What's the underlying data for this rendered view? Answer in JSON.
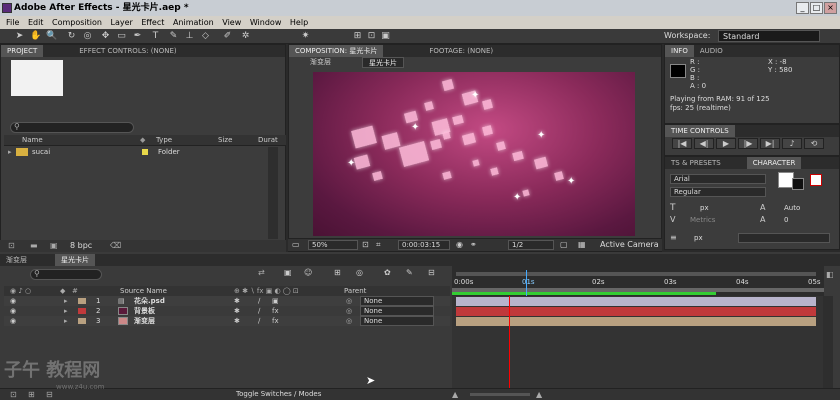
{
  "window": {
    "title": "Adobe After Effects - 星光卡片.aep *",
    "min": "_",
    "max": "□",
    "close": "×"
  },
  "menu": [
    "File",
    "Edit",
    "Composition",
    "Layer",
    "Effect",
    "Animation",
    "View",
    "Window",
    "Help"
  ],
  "workspace": {
    "label": "Workspace:",
    "value": "Standard"
  },
  "project_panel": {
    "tabs": [
      "PROJECT",
      "EFFECT CONTROLS: (none)"
    ],
    "columns": [
      "Name",
      "Type",
      "Size",
      "Durat"
    ],
    "items": [
      {
        "name": "sucai",
        "type": "Folder"
      }
    ],
    "bpc": "8 bpc"
  },
  "comp_panel": {
    "tabs": [
      "COMPOSITION: 星光卡片",
      "FOOTAGE: (none)"
    ],
    "breadcrumbs": [
      "渐变层",
      "星光卡片"
    ],
    "zoom": "50%",
    "timecode": "0:00:03:15",
    "resolution": "1/2",
    "camera": "Active Camera"
  },
  "info_panel": {
    "tabs": [
      "INFO",
      "AUDIO"
    ],
    "r": "R :",
    "g": "G :",
    "b": "B :",
    "a": "A : 0",
    "x": "X : -8",
    "y": "Y : 580",
    "status1": "Playing from RAM: 91 of 125",
    "status2": "fps: 25 (realtime)"
  },
  "time_controls": {
    "tab": "TIME CONTROLS"
  },
  "character_panel": {
    "tabs": [
      "TS & PRESETS",
      "CHARACTER"
    ],
    "font": "Arial",
    "style": "Regular",
    "size_unit": "px",
    "leading": "Auto",
    "metrics": "Metrics",
    "tracking": "0",
    "stroke_unit": "px"
  },
  "timeline": {
    "tabs": [
      "渐变层",
      "星光卡片"
    ],
    "header": {
      "source_name": "Source Name",
      "parent": "Parent"
    },
    "ruler": [
      "0:00s",
      "01s",
      "02s",
      "03s",
      "04s",
      "05s"
    ],
    "layers": [
      {
        "num": "1",
        "name": "花朵.psd",
        "parent": "None",
        "color": "#b8a080"
      },
      {
        "num": "2",
        "name": "背景板",
        "parent": "None",
        "color": "#c0393b"
      },
      {
        "num": "3",
        "name": "渐变层",
        "parent": "None",
        "color": "#b8a080"
      }
    ],
    "toggle": "Toggle Switches / Modes"
  },
  "watermark": {
    "text": "子午 教程网",
    "sub": "www.z4u.com"
  }
}
